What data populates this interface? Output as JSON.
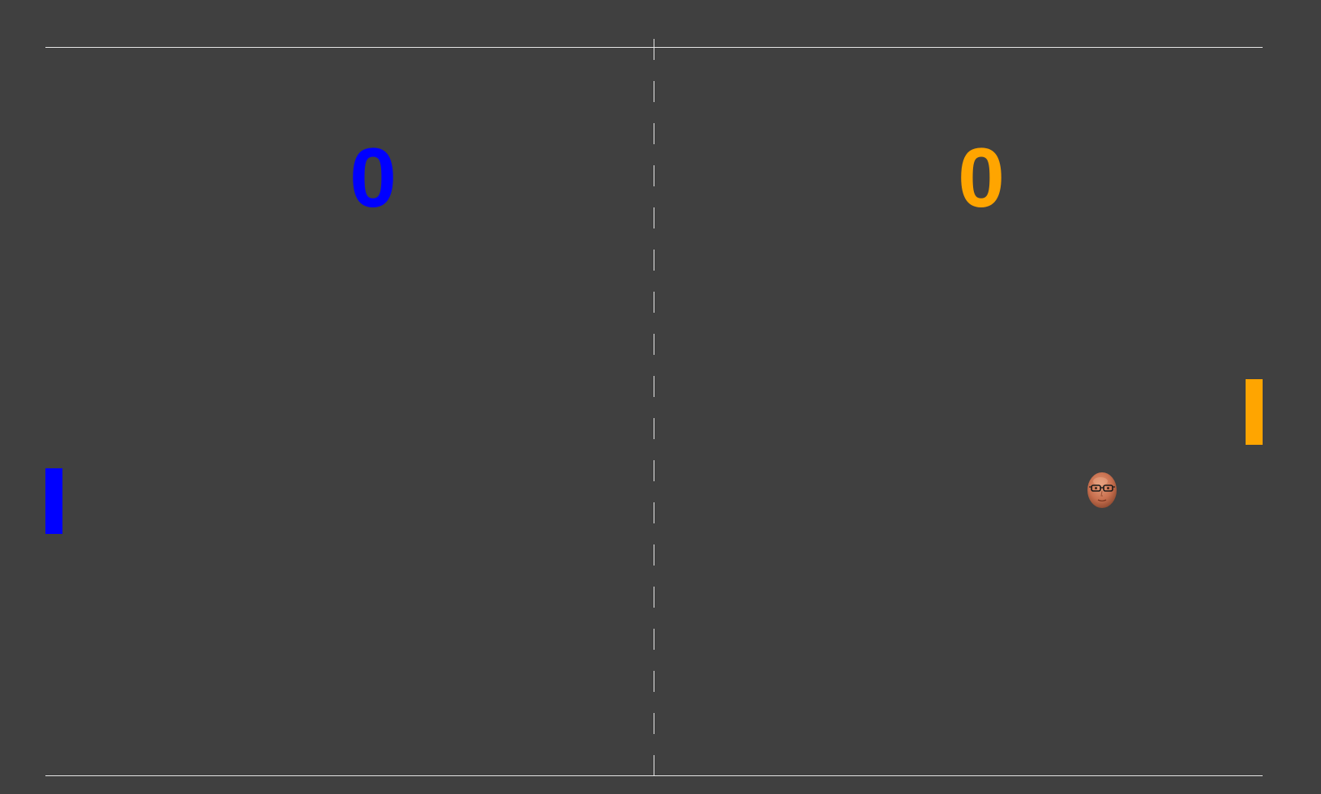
{
  "scoreboard": {
    "left_score": "0",
    "right_score": "0"
  },
  "players": {
    "left": {
      "color": "#0000ff"
    },
    "right": {
      "color": "#ffa500"
    }
  },
  "court": {
    "background_color": "#404040",
    "line_color": "#e6e6e6"
  },
  "ball": {
    "icon": "face-ball-icon"
  }
}
